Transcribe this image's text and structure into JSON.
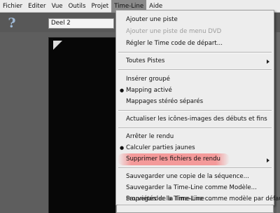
{
  "menubar": {
    "items": [
      "Fichier",
      "Editer",
      "Vue",
      "Outils",
      "Projet",
      "Time-Line",
      "Aide"
    ]
  },
  "toolbar": {
    "help_icon": "help-icon",
    "name_field_value": "Deel 2"
  },
  "timeline_menu": {
    "items": [
      {
        "label": "Ajouter une piste"
      },
      {
        "label": "Ajouter une piste de menu DVD",
        "disabled": true
      },
      {
        "label": "Régler le Time code de départ..."
      },
      {
        "label": "Toutes Pistes",
        "submenu": true
      },
      {
        "label": "Insérer groupé"
      },
      {
        "label": "Mapping activé",
        "checked": true
      },
      {
        "label": "Mappages stéréo séparés"
      },
      {
        "label": "Actualiser les icônes-images des débuts et fins"
      },
      {
        "label": "Arrêter le rendu"
      },
      {
        "label": "Calculer parties jaunes",
        "checked": true
      },
      {
        "label": "Supprimer les fichiers de rendu",
        "submenu": true,
        "highlighted": true
      },
      {
        "label": "Sauvegarder une copie de la séquence..."
      },
      {
        "label": "Sauvegarder la Time-Line comme Modèle..."
      },
      {
        "label": "Sauvegarder la Time-Line comme modèle par défaut"
      },
      {
        "label": "Propriétés de la Time-Line ..."
      }
    ]
  },
  "colors": {
    "highlight": "#f49696",
    "menu_background": "#ededed",
    "workspace": "#5e5e5e"
  }
}
